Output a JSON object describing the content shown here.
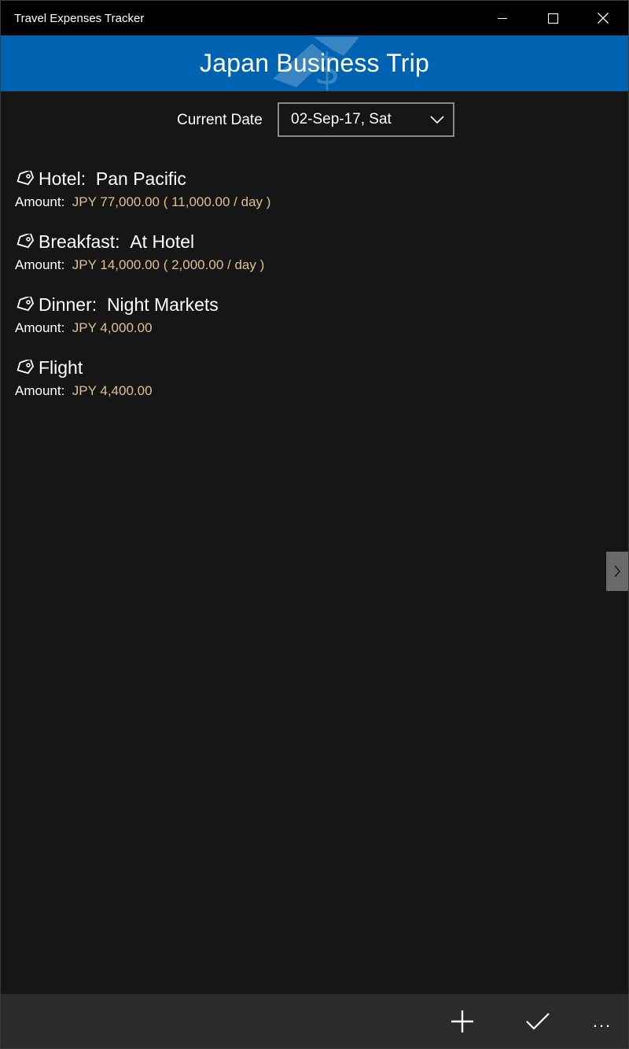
{
  "window": {
    "title": "Travel Expenses Tracker"
  },
  "header": {
    "title": "Japan Business Trip"
  },
  "date_picker": {
    "label": "Current Date",
    "value": "02-Sep-17, Sat"
  },
  "expenses": [
    {
      "category": "Hotel",
      "separator": ":  ",
      "detail": "Pan Pacific",
      "amount_label": "Amount:  ",
      "amount": "JPY 77,000.00 ( 11,000.00 / day )"
    },
    {
      "category": "Breakfast",
      "separator": ":  ",
      "detail": "At Hotel",
      "amount_label": "Amount:  ",
      "amount": "JPY 14,000.00 ( 2,000.00 / day )"
    },
    {
      "category": "Dinner",
      "separator": ":  ",
      "detail": "Night Markets",
      "amount_label": "Amount:  ",
      "amount": "JPY 4,000.00"
    },
    {
      "category": "Flight",
      "separator": "",
      "detail": "",
      "amount_label": "Amount:  ",
      "amount": "JPY 4,400.00"
    }
  ],
  "command_bar": {
    "more_label": "..."
  },
  "colors": {
    "accent": "#0063b1",
    "background": "#161616",
    "amount_text": "#d9c28f"
  },
  "icons": {
    "tag": "tag-icon",
    "add": "add-icon",
    "accept": "checkmark-icon",
    "more": "more-icon"
  }
}
